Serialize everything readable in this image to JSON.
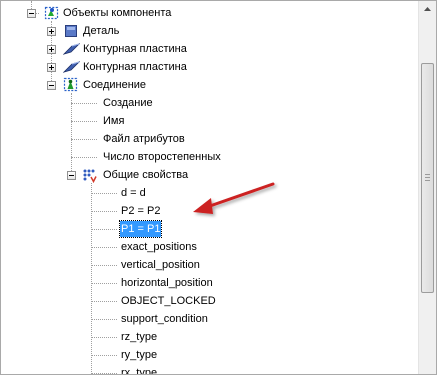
{
  "tree": {
    "root": {
      "label": "Объекты компонента",
      "icon": "component-objects-icon",
      "expander": "minus"
    },
    "children": [
      {
        "label": "Деталь",
        "icon": "part-icon",
        "expander": "plus"
      },
      {
        "label": "Контурная пластина",
        "icon": "contour-plate-icon",
        "expander": "plus"
      },
      {
        "label": "Контурная пластина",
        "icon": "contour-plate-icon",
        "expander": "plus"
      },
      {
        "label": "Соединение",
        "icon": "connection-icon",
        "expander": "minus"
      }
    ],
    "connection_children": [
      {
        "label": "Создание"
      },
      {
        "label": "Имя"
      },
      {
        "label": "Файл атрибутов"
      },
      {
        "label": "Число второстепенных"
      },
      {
        "label": "Общие свойства",
        "icon": "general-properties-icon",
        "expander": "minus"
      }
    ],
    "properties": [
      {
        "label": "d = d"
      },
      {
        "label": "P2 = P2"
      },
      {
        "label": "P1 = P1",
        "selected": true
      },
      {
        "label": "exact_positions"
      },
      {
        "label": "vertical_position"
      },
      {
        "label": "horizontal_position"
      },
      {
        "label": "OBJECT_LOCKED"
      },
      {
        "label": "support_condition"
      },
      {
        "label": "rz_type"
      },
      {
        "label": "ry_type"
      },
      {
        "label": "rx_type"
      }
    ]
  },
  "colors": {
    "selection": "#3399ff",
    "annotation_arrow": "#cc2222"
  },
  "scrollbar": {
    "up_icon": "scroll-up-icon"
  }
}
